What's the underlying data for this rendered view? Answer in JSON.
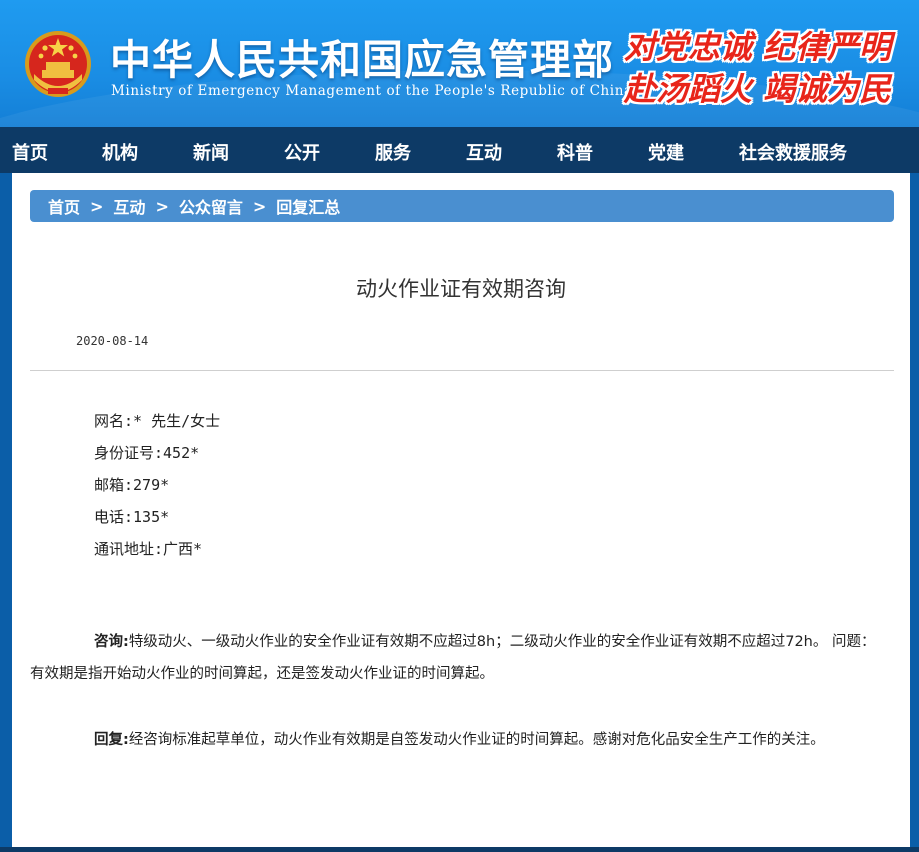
{
  "header": {
    "site_name": "中华人民共和国应急管理部",
    "site_name_en": "Ministry of Emergency Management of the People's Republic of China",
    "slogan_line1": "对党忠诚  纪律严明",
    "slogan_line2": "赴汤蹈火  竭诚为民",
    "slogan_color": "#e8251a"
  },
  "nav": {
    "items": [
      "首页",
      "机构",
      "新闻",
      "公开",
      "服务",
      "互动",
      "科普",
      "党建",
      "社会救援服务"
    ]
  },
  "breadcrumb": {
    "items": [
      "首页",
      "互动",
      "公众留言",
      "回复汇总"
    ],
    "separator": ">"
  },
  "article": {
    "title": "动火作业证有效期咨询",
    "date": "2020-08-14",
    "info": {
      "name": "网名:* 先生/女士",
      "id_number": "身份证号:452*",
      "email": "邮箱:279*",
      "phone": "电话:135*",
      "address": "通讯地址:广西*"
    },
    "question_label": "咨询:",
    "question_text": "特级动火、一级动火作业的安全作业证有效期不应超过8h；二级动火作业的安全作业证有效期不应超过72h。 问题：有效期是指开始动火作业的时间算起，还是签发动火作业证的时间算起。",
    "reply_label": "回复:",
    "reply_text": "经咨询标准起草单位，动火作业有效期是自签发动火作业证的时间算起。感谢对危化品安全生产工作的关注。"
  }
}
